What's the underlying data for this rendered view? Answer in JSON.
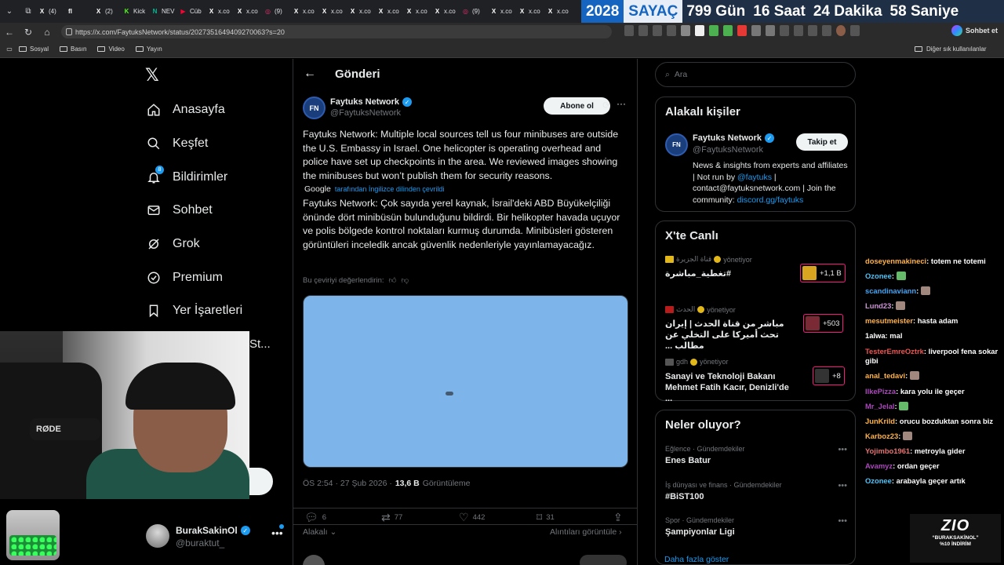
{
  "browser": {
    "tabs": [
      {
        "label": "(4)",
        "fav": "X",
        "color": "#ffffff"
      },
      {
        "label": "",
        "fav": "fl",
        "color": "#ffffff"
      },
      {
        "label": "(2)",
        "fav": "X",
        "color": "#ffffff"
      },
      {
        "label": "Kick",
        "fav": "K",
        "color": "#53fc18"
      },
      {
        "label": "NEV",
        "fav": "N",
        "color": "#00b894"
      },
      {
        "label": "Cüb",
        "fav": "▶",
        "color": "#ff0033"
      },
      {
        "label": "x.co",
        "fav": "X",
        "color": "#ffffff"
      },
      {
        "label": "x.co",
        "fav": "X",
        "color": "#ffffff"
      },
      {
        "label": "(9)",
        "fav": "◎",
        "color": "#e1306c"
      },
      {
        "label": "x.co",
        "fav": "X",
        "color": "#ffffff"
      },
      {
        "label": "x.co",
        "fav": "X",
        "color": "#ffffff"
      },
      {
        "label": "x.co",
        "fav": "X",
        "color": "#ffffff"
      },
      {
        "label": "x.co",
        "fav": "X",
        "color": "#ffffff"
      },
      {
        "label": "x.co",
        "fav": "X",
        "color": "#ffffff"
      },
      {
        "label": "x.co",
        "fav": "X",
        "color": "#ffffff"
      },
      {
        "label": "(9)",
        "fav": "◎",
        "color": "#e1306c"
      },
      {
        "label": "x.co",
        "fav": "X",
        "color": "#ffffff"
      },
      {
        "label": "x.co",
        "fav": "X",
        "color": "#ffffff"
      },
      {
        "label": "x.co",
        "fav": "X",
        "color": "#ffffff"
      }
    ],
    "url": "https://x.com/FaytuksNetwork/status/2027351649409270063?s=20",
    "chat_button": "Sohbet et",
    "bookmarks": [
      "Sosyal",
      "Basın",
      "Video",
      "Yayın"
    ],
    "other_bookmarks": "Diğer sık kullanılanlar"
  },
  "counter": {
    "year": "2028",
    "label": "SAYAÇ",
    "days": "799 Gün",
    "hours": "16 Saat",
    "minutes": "24 Dakika",
    "seconds": "58 Saniye"
  },
  "nav": {
    "items": [
      {
        "label": "Anasayfa",
        "icon": "home-icon"
      },
      {
        "label": "Keşfet",
        "icon": "search-icon"
      },
      {
        "label": "Bildirimler",
        "icon": "bell-icon",
        "badge": "8"
      },
      {
        "label": "Sohbet",
        "icon": "mail-icon"
      },
      {
        "label": "Grok",
        "icon": "grok-icon"
      },
      {
        "label": "Premium",
        "icon": "premium-icon"
      },
      {
        "label": "Yer İşaretleri",
        "icon": "bookmark-icon"
      }
    ],
    "more_fragment": "St...",
    "account_name": "BurakSakinOl",
    "account_handle": "@buraktut_"
  },
  "webcam": {
    "mic_label": "RØDE"
  },
  "post": {
    "header_title": "Gönderi",
    "author_name": "Faytuks Network",
    "author_handle": "@FaytuksNetwork",
    "avatar_text": "FN",
    "subscribe_label": "Abone ol",
    "text": "Faytuks Network: Multiple local sources tell us four minibuses are outside the U.S. Embassy in Israel. One helicopter is operating overhead and police have set up checkpoints in the area. We reviewed images showing the minibuses but won’t publish them for security reasons.",
    "translated_by": "Google",
    "translated_note": "tarafından İngilizce dilinden çevrildi",
    "translation": "Faytuks Network: Çok sayıda yerel kaynak, İsrail'deki ABD Büyükelçiliği önünde dört minibüsün bulunduğunu bildirdi. Bir helikopter havada uçuyor ve polis bölgede kontrol noktaları kurmuş durumda. Minibüsleri gösteren görüntüleri inceledik ancak güvenlik nedenleriyle yayınlamayacağız.",
    "rate_translation": "Bu çeviriyi değerlendirin:",
    "time": "ÖS 2:54 · 27 Şub 2026 ·",
    "views": "13,6 B",
    "views_label": "Görüntüleme",
    "replies": "6",
    "reposts": "77",
    "likes": "442",
    "bookmarks": "31",
    "relevant_label": "Alakalı",
    "quotes_label": "Alıntıları görüntüle"
  },
  "right": {
    "search_placeholder": "Ara",
    "related_title": "Alakalı kişiler",
    "related": {
      "name": "Faytuks Network",
      "handle": "@FaytuksNetwork",
      "avatar_text": "FN",
      "follow_label": "Takip et",
      "bio_1": "News & insights from experts and affiliates | Not run by ",
      "bio_link": "@faytuks",
      "bio_2": " | contact@faytuksnetwork.com | Join the community: ",
      "bio_link2": "discord.gg/faytuks"
    },
    "live_title": "X'te Canlı",
    "live": [
      {
        "source": "قناة الجزيرة",
        "role": "yönetiyor",
        "title": "تغطية_مباشرة#",
        "count": "+1,1 B",
        "src_color": "#e2b719",
        "thumb_color": "#d9a521",
        "rtl": false
      },
      {
        "source": "الحدث",
        "role": "yönetiyor",
        "title": "مباشر من قناة الحدث | إيران تحث أميركا على التخلي عن مطالب ...",
        "count": "+503",
        "src_color": "#b71c1c",
        "thumb_color": "#7a2a34",
        "rtl": true
      },
      {
        "source": "gdh",
        "role": "yönetiyor",
        "title": "Sanayi ve Teknoloji Bakanı Mehmet Fatih Kacır, Denizli'de ...",
        "count": "+8",
        "src_color": "#555555",
        "thumb_color": "#333333",
        "rtl": false
      }
    ],
    "trends_title": "Neler oluyor?",
    "trends": [
      {
        "category": "Eğlence · Gündemdekiler",
        "name": "Enes Batur"
      },
      {
        "category": "İş dünyası ve finans · Gündemdekiler",
        "name": "#BiST100"
      },
      {
        "category": "Spor · Gündemdekiler",
        "name": "Şampiyonlar Ligi"
      }
    ],
    "show_more": "Daha fazla göster"
  },
  "chat": [
    {
      "user": "doseyenmakineci",
      "color": "#ffb347",
      "text": "totem ne totemi"
    },
    {
      "user": "Ozonee",
      "color": "#4fc3f7",
      "text": "",
      "emote": "#66bb6a"
    },
    {
      "user": "scandinaviann",
      "color": "#42a5f5",
      "text": "",
      "emote": "#a1887f"
    },
    {
      "user": "Lund23",
      "color": "#ce93d8",
      "text": "",
      "emote": "#a1887f"
    },
    {
      "user": "mesutmeister",
      "color": "#ffb347",
      "text": "hasta adam"
    },
    {
      "user": "1alwa",
      "color": "#ffffff",
      "text": "mal"
    },
    {
      "user": "TesterEmreOztrk",
      "color": "#ef5350",
      "text": "liverpool fena sokar gibi"
    },
    {
      "user": "anal_tedavi",
      "color": "#ffb347",
      "text": "",
      "emote": "#a1887f"
    },
    {
      "user": "IlkePizza",
      "color": "#ab47bc",
      "text": "kara yolu ile geçer"
    },
    {
      "user": "Mr_Jelal",
      "color": "#ab47bc",
      "text": "",
      "emote": "#66bb6a"
    },
    {
      "user": "JunKrild",
      "color": "#ffb347",
      "text": "orucu bozduktan sonra biz"
    },
    {
      "user": "Karboz23",
      "color": "#ffb347",
      "text": "",
      "emote": "#a1887f"
    },
    {
      "user": "Yojimbo1961",
      "color": "#e57373",
      "text": "metroyla gider"
    },
    {
      "user": "Avamyz",
      "color": "#ab47bc",
      "text": "ordan geçer"
    },
    {
      "user": "Ozonee",
      "color": "#4fc3f7",
      "text": "arabayla geçer artık"
    }
  ],
  "sponsor": {
    "logo": "ZIO",
    "code": "“BURAKSAKİNOL”",
    "discount": "%10 İNDİRİM"
  }
}
